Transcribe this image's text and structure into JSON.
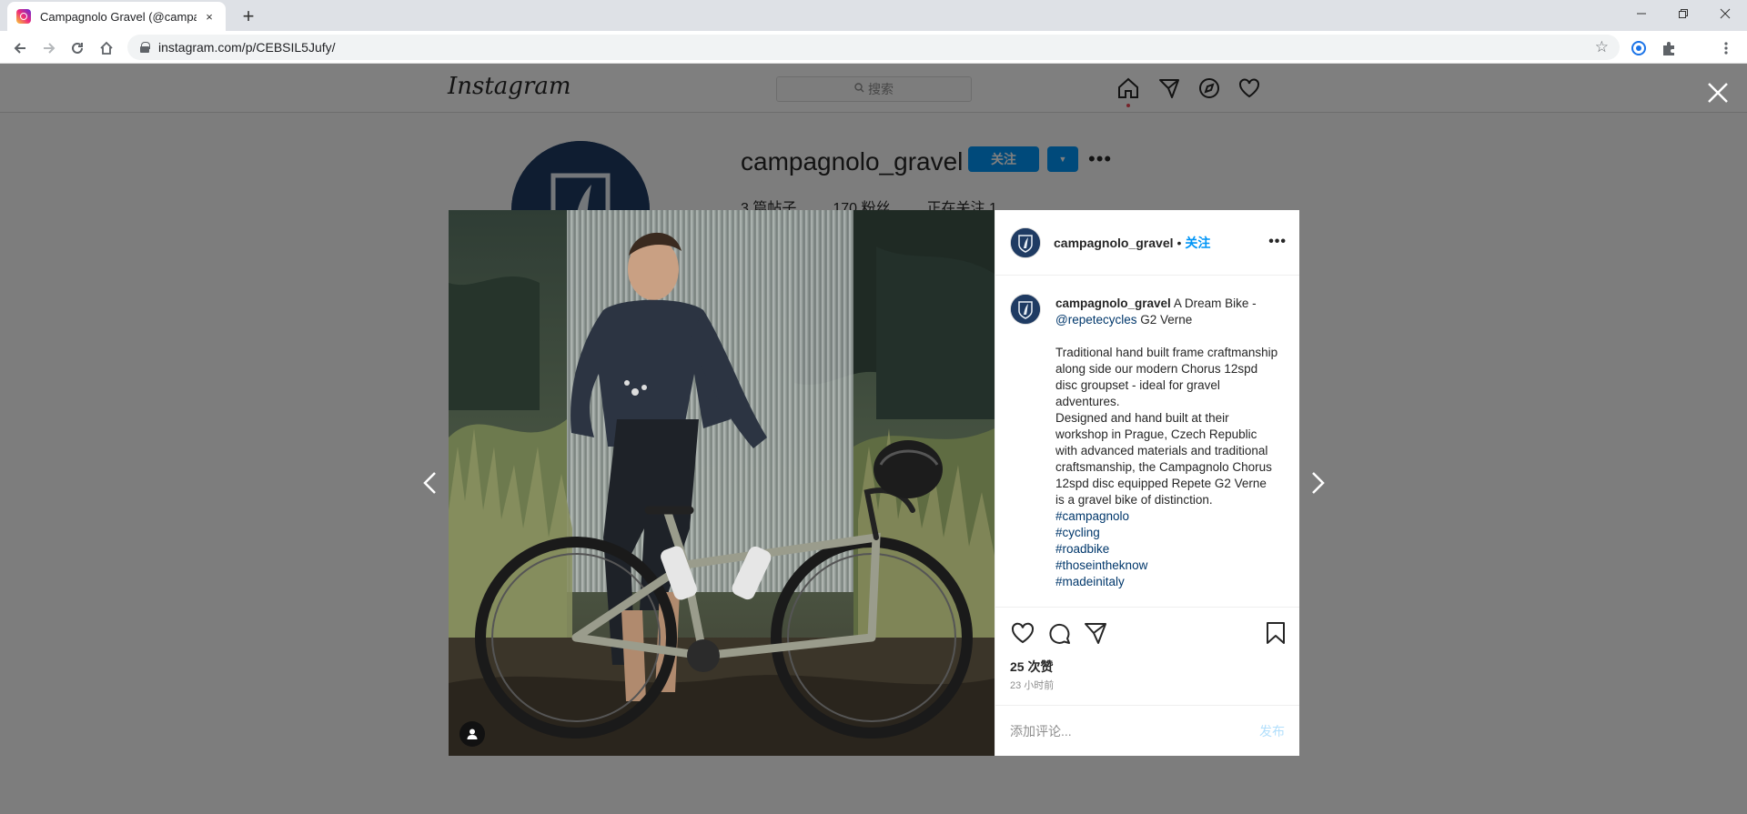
{
  "browser": {
    "tab_title": "Campagnolo Gravel (@campagnolo_gravel)",
    "tab_close": "×",
    "new_tab": "+",
    "url": "instagram.com/p/CEBSIL5Jufy/"
  },
  "instagram": {
    "logo": "Instagram",
    "search_placeholder": "搜索"
  },
  "profile": {
    "username": "campagnolo_gravel",
    "follow_label": "关注",
    "stats": [
      "3 篇帖子",
      "170 粉丝",
      "正在关注 1"
    ]
  },
  "post": {
    "username": "campagnolo_gravel",
    "dot": "•",
    "follow_label": "关注",
    "caption_intro": "A Dream Bike -",
    "caption_mention": "@repetecycles",
    "caption_model": "G2 Verne",
    "caption_para": "Traditional hand built frame craftmanship along side our modern Chorus 12spd disc groupset - ideal for gravel adventures.\nDesigned and hand built at their workshop in Prague, Czech Republic with advanced materials and traditional craftsmanship, the Campagnolo Chorus 12spd disc equipped Repete G2 Verne is a gravel bike of distinction.",
    "hashtags": [
      "#campagnolo",
      "#cycling",
      "#roadbike",
      "#thoseintheknow",
      "#madeinitaly"
    ],
    "likes": "25 次赞",
    "time": "23 小时前",
    "comment_placeholder": "添加评论...",
    "post_label": "发布"
  },
  "colors": {
    "accent": "#0095f6",
    "link": "#00376b",
    "avatar_bg": "#1f3b63"
  }
}
